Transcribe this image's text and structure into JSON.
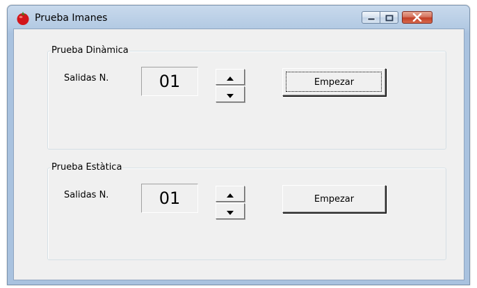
{
  "window": {
    "title": "Prueba Imanes",
    "icon": "tomato-icon"
  },
  "dynamic_group": {
    "legend": "Prueba Dinàmica",
    "field_label": "Salidas N.",
    "value": "01",
    "start_label": "Empezar"
  },
  "static_group": {
    "legend": "Prueba Estàtica",
    "field_label": "Salidas N.",
    "value": "01",
    "start_label": "Empezar"
  },
  "colors": {
    "close_button": "#c23f26",
    "client_background": "#f0f0f0",
    "title_bar": "#b3cae3"
  }
}
